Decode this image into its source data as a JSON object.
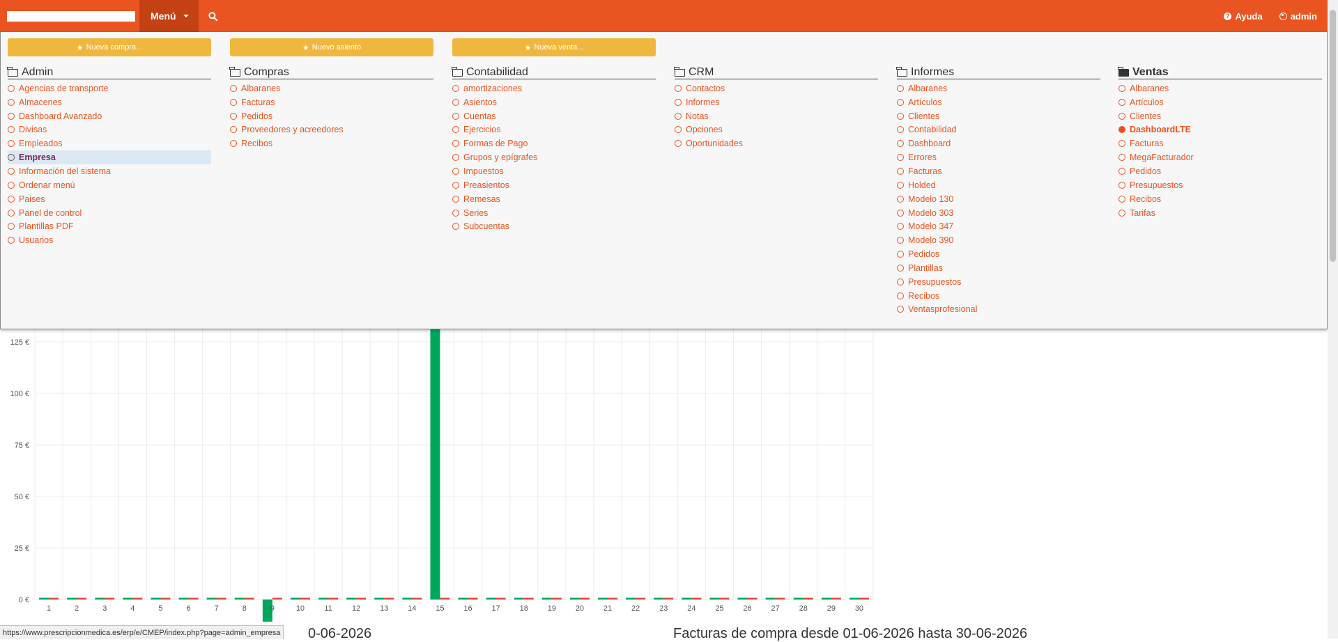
{
  "navbar": {
    "menu_label": "Menú",
    "help_label": "Ayuda",
    "user_label": "admin",
    "colors": {
      "bar": "#e95420",
      "menu_active": "#c34113"
    }
  },
  "quick_actions": [
    {
      "label": "Nueva compra..."
    },
    {
      "label": "Nuevo asiento"
    },
    {
      "label": "Nueva venta..."
    }
  ],
  "menu": {
    "columns": [
      {
        "title": "Admin",
        "items": [
          "Agencias de transporte",
          "Almacenes",
          "Dashboard Avanzado",
          "Divisas",
          "Empleados",
          "Empresa",
          "Información del sistema",
          "Ordenar menú",
          "Paises",
          "Panel de control",
          "Plantillas PDF",
          "Usuarios"
        ],
        "active_item": "Empresa"
      },
      {
        "title": "Compras",
        "items": [
          "Albaranes",
          "Facturas",
          "Pedidos",
          "Proveedores y acreedores",
          "Recibos"
        ]
      },
      {
        "title": "Contabilidad",
        "items": [
          "amortizaciones",
          "Asientos",
          "Cuentas",
          "Ejercicios",
          "Formas de Pago",
          "Grupos y epígrafes",
          "Impuestos",
          "Preasientos",
          "Remesas",
          "Series",
          "Subcuentas"
        ]
      },
      {
        "title": "CRM",
        "items": [
          "Contactos",
          "Informes",
          "Notas",
          "Opciones",
          "Oportunidades"
        ]
      },
      {
        "title": "Informes",
        "items": [
          "Albaranes",
          "Artículos",
          "Clientes",
          "Contabilidad",
          "Dashboard",
          "Errores",
          "Facturas",
          "Holded",
          "Modelo 130",
          "Modelo 303",
          "Modelo 347",
          "Modelo 390",
          "Pedidos",
          "Plantillas",
          "Presupuestos",
          "Recibos",
          "Ventasprofesional"
        ]
      },
      {
        "title": "Ventas",
        "items": [
          "Albaranes",
          "Artículos",
          "Clientes",
          "DashboardLTE",
          "Facturas",
          "MegaFacturador",
          "Pedidos",
          "Presupuestos",
          "Recibos",
          "Tarifas"
        ],
        "current_item": "DashboardLTE"
      }
    ]
  },
  "chart_data": {
    "type": "bar",
    "categories": [
      "1",
      "2",
      "3",
      "4",
      "5",
      "6",
      "7",
      "8",
      "9",
      "10",
      "11",
      "12",
      "13",
      "14",
      "15",
      "16",
      "17",
      "18",
      "19",
      "20",
      "21",
      "22",
      "23",
      "24",
      "25",
      "26",
      "27",
      "28",
      "29",
      "30"
    ],
    "y_ticks": [
      "0 €",
      "25 €",
      "50 €",
      "75 €",
      "100 €",
      "125 €"
    ],
    "ylim": [
      0,
      135
    ],
    "series": [
      {
        "color": "#00a65a",
        "values": [
          0,
          0,
          0,
          0,
          0,
          0,
          0,
          0,
          -6,
          0,
          0,
          0,
          0,
          0,
          135,
          0,
          0,
          0,
          0,
          0,
          0,
          0,
          0,
          0,
          0,
          0,
          0,
          0,
          0,
          0
        ]
      },
      {
        "color": "#dd4b39",
        "values": [
          0,
          0,
          0,
          0,
          0,
          0,
          0,
          0,
          0,
          0,
          0,
          0,
          0,
          0,
          0,
          0,
          0,
          0,
          0,
          0,
          0,
          0,
          0,
          0,
          0,
          0,
          0,
          0,
          0,
          0
        ]
      }
    ],
    "grid": true
  },
  "bottom": {
    "left_heading_fragment": "0-06-2026",
    "right_heading": "Facturas de compra desde 01-06-2026 hasta 30-06-2026"
  },
  "status_bar_url": "https://www.prescripcionmedica.es/erp/e/CMEP/index.php?page=admin_empresa"
}
